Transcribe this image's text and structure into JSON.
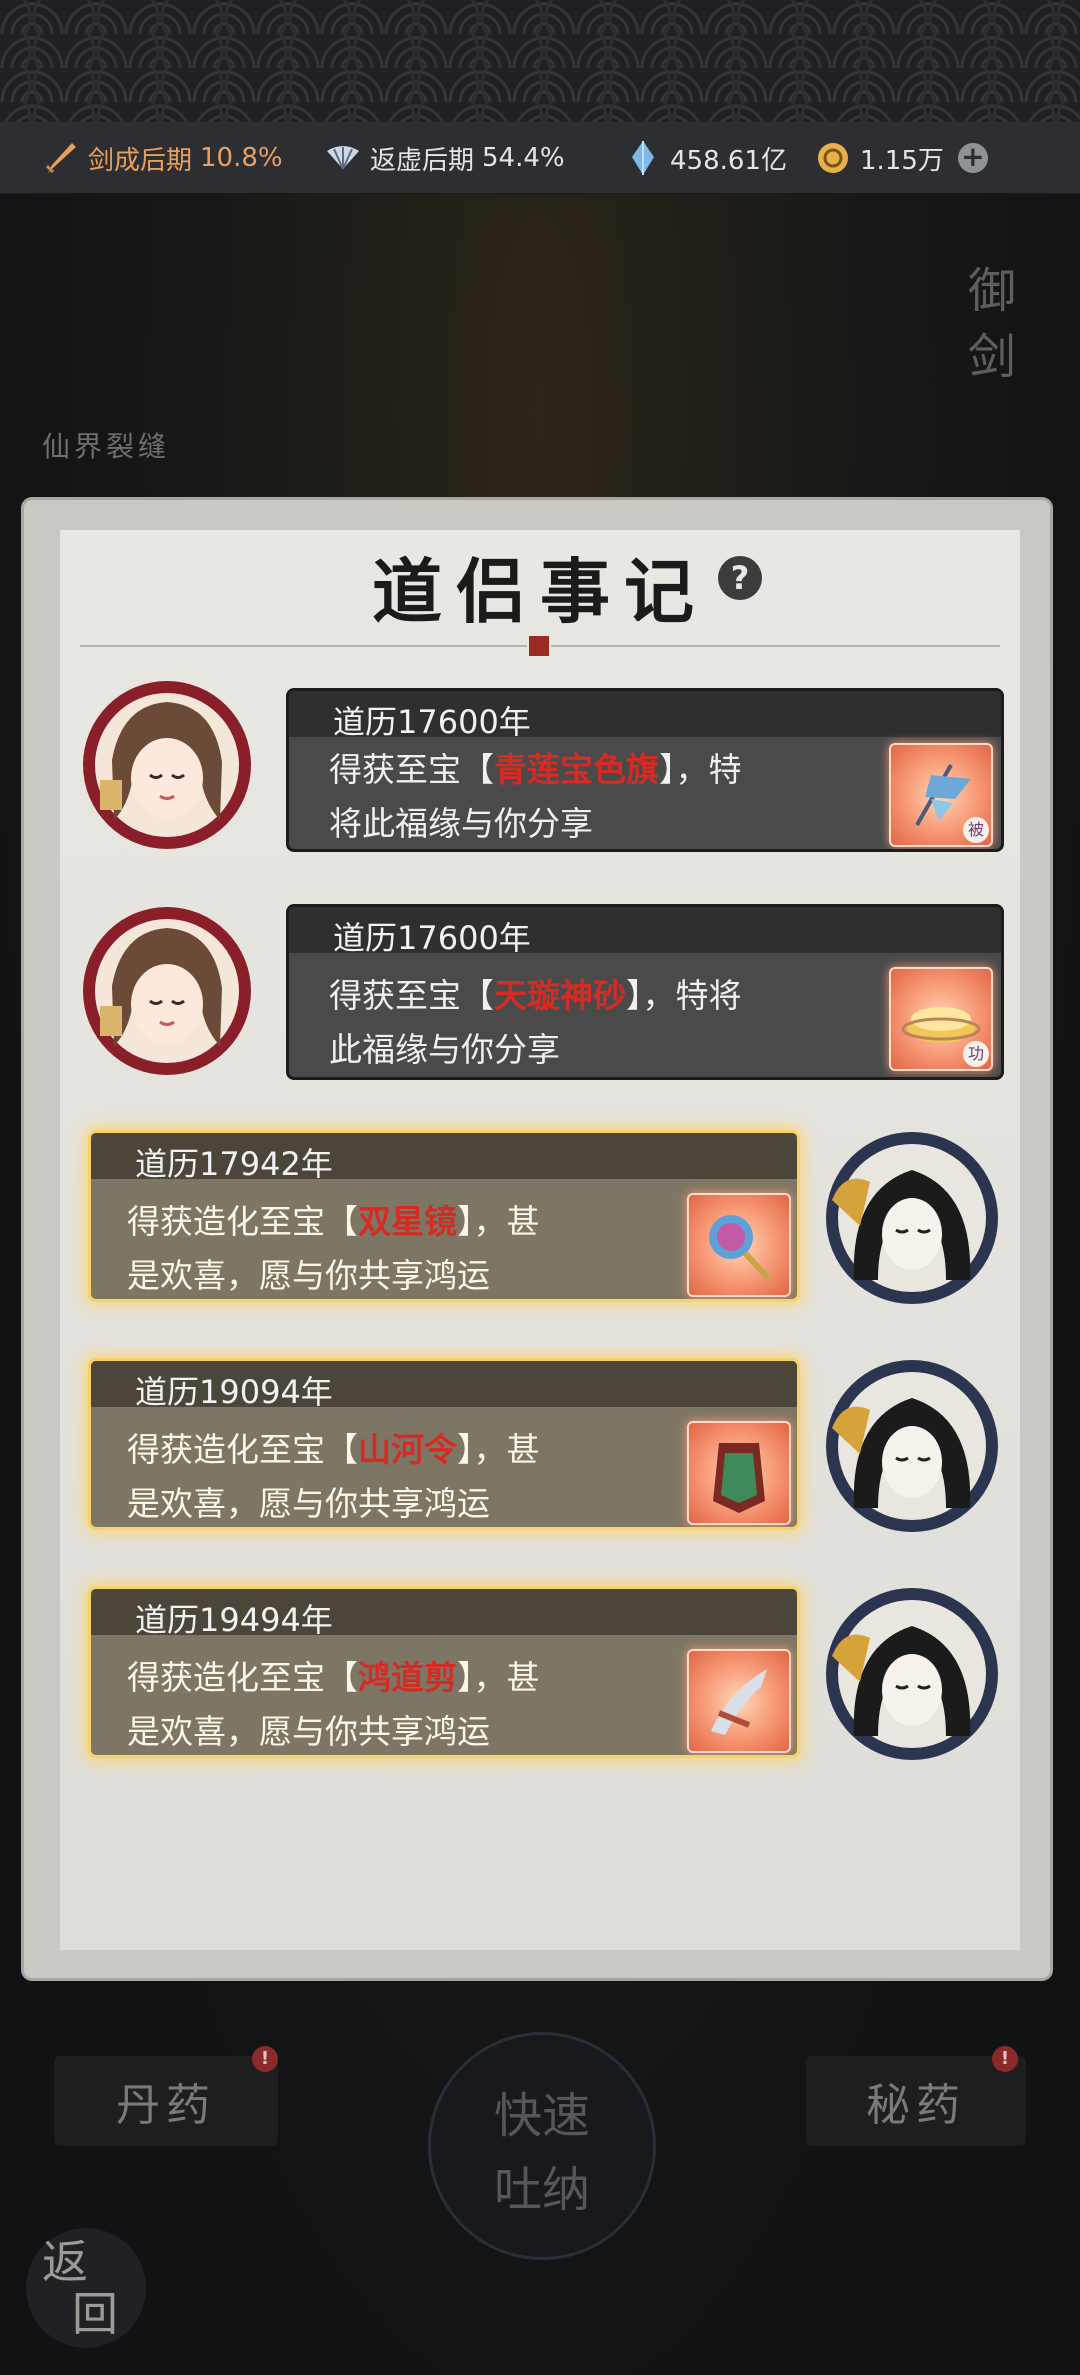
{
  "status_bar": {
    "sword_stage": "剑成后期",
    "sword_percent": "10.8%",
    "fan_stage": "返虚后期",
    "fan_percent": "54.4%",
    "crystal_amount": "458.61亿",
    "coin_amount": "1.15万",
    "plus_label": "+"
  },
  "background": {
    "left_label": "仙界裂缝",
    "right_label": "御剑"
  },
  "panel": {
    "title": "道侣事记",
    "help_label": "?"
  },
  "entries": [
    {
      "date": "道历17600年",
      "line1_pre": "得获至宝【",
      "item": "青莲宝色旗",
      "line1_post": "】，特",
      "line2": "将此福缘与你分享",
      "tag": "被"
    },
    {
      "date": "道历17600年",
      "line1_pre": "得获至宝【",
      "item": "天璇神砂",
      "line1_post": "】，特将",
      "line2": "此福缘与你分享",
      "tag": "功"
    },
    {
      "date": "道历17942年",
      "line1_pre": "得获造化至宝【",
      "item": "双星镜",
      "line1_post": "】，甚",
      "line2": "是欢喜，愿与你共享鸿运"
    },
    {
      "date": "道历19094年",
      "line1_pre": "得获造化至宝【",
      "item": "山河令",
      "line1_post": "】，甚",
      "line2": "是欢喜，愿与你共享鸿运"
    },
    {
      "date": "道历19494年",
      "line1_pre": "得获造化至宝【",
      "item": "鸿道剪",
      "line1_post": "】，甚",
      "line2": "是欢喜，愿与你共享鸿运"
    }
  ],
  "bottom": {
    "elixir_label": "丹药",
    "secret_label": "秘药",
    "quick_line1": "快速",
    "quick_line2": "吐纳",
    "back_line1": "返",
    "back_line2": "回",
    "badge": "!"
  },
  "colors": {
    "highlight_red": "#d52b25",
    "gold_glow": "#f3d36a",
    "accent_orange": "#e8a060"
  }
}
